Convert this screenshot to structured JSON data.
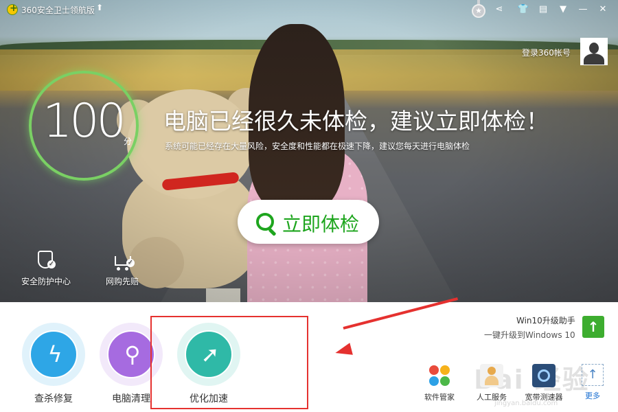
{
  "app": {
    "title": "360安全卫士领航版"
  },
  "account": {
    "login_label": "登录360帐号"
  },
  "score": {
    "value": "100",
    "unit": "分"
  },
  "hero": {
    "headline": "电脑已经很久未体检，建议立即体检！",
    "subline": "系统可能已经存在大量风险，安全度和性能都在极速下降，建议您每天进行电脑体检",
    "check_button_label": "立即体检"
  },
  "hero_tools": [
    {
      "label": "安全防护中心",
      "icon": "shield-check-icon"
    },
    {
      "label": "网购先赔",
      "icon": "shopping-cart-icon"
    }
  ],
  "features": [
    {
      "label": "查杀修复",
      "icon": "lightning-icon",
      "color": "#2ea6e6"
    },
    {
      "label": "电脑清理",
      "icon": "broom-icon",
      "color": "#a66be0"
    },
    {
      "label": "优化加速",
      "icon": "rocket-icon",
      "color": "#2fb9a7"
    }
  ],
  "win10": {
    "title": "Win10升级助手",
    "subtitle": "一键升级到Windows 10"
  },
  "tools": [
    {
      "label": "软件管家",
      "icon": "software-manager-icon"
    },
    {
      "label": "人工服务",
      "icon": "manual-service-icon"
    },
    {
      "label": "宽带测速器",
      "icon": "speed-test-icon"
    },
    {
      "label": "更多",
      "icon": "more-icon",
      "color": "#1a6fd1"
    }
  ],
  "watermark": {
    "text": "Bai 经验",
    "sub": "jingyan.baidu.com"
  },
  "annotation": {
    "highlight_color": "#e5312f"
  }
}
